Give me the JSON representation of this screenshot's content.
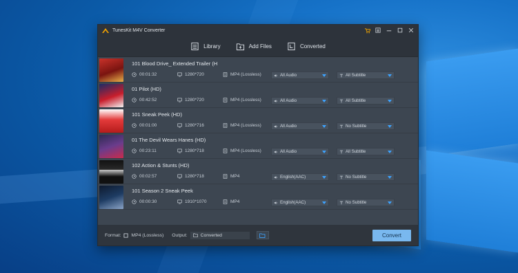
{
  "window": {
    "title": "TunesKit M4V Converter"
  },
  "toolbar": {
    "library_label": "Library",
    "add_files_label": "Add Files",
    "converted_label": "Converted"
  },
  "colors": {
    "accent": "#3da3ff",
    "convert_button": "#79b8ef",
    "window_bg": "#3d4651",
    "titlebar_bg": "#2d333b"
  },
  "rows": [
    {
      "title": "101 Blood Drive_ Extended Trailer (H",
      "duration": "00:01:32",
      "resolution": "1280*720",
      "format": "MP4 (Lossless)",
      "audio": "All Audio",
      "subtitle": "All Subtitle",
      "thumb_icon": "poster-blood-drive"
    },
    {
      "title": "01 Pilot (HD)",
      "duration": "00:42:52",
      "resolution": "1280*720",
      "format": "MP4 (Lossless)",
      "audio": "All Audio",
      "subtitle": "All Subtitle",
      "thumb_icon": "poster-pilot"
    },
    {
      "title": "101 Sneak Peek (HD)",
      "duration": "00:01:00",
      "resolution": "1280*716",
      "format": "MP4 (Lossless)",
      "audio": "All Audio",
      "subtitle": "No Subtitle",
      "thumb_icon": "poster-sneak-peek"
    },
    {
      "title": "01 The Devil Wears Hanes (HD)",
      "duration": "00:23:11",
      "resolution": "1280*718",
      "format": "MP4 (Lossless)",
      "audio": "All Audio",
      "subtitle": "All Subtitle",
      "thumb_icon": "poster-devil-wears-hanes"
    },
    {
      "title": "102 Action & Stunts (HD)",
      "duration": "00:02:57",
      "resolution": "1280*718",
      "format": "MP4",
      "audio": "English(AAC)",
      "subtitle": "No Subtitle",
      "thumb_icon": "poster-action-stunts"
    },
    {
      "title": "101 Season 2 Sneak Peek",
      "duration": "00:00:30",
      "resolution": "1910*1070",
      "format": "MP4",
      "audio": "English(AAC)",
      "subtitle": "No Subtitle",
      "thumb_icon": "poster-season-2"
    }
  ],
  "bottom": {
    "format_label": "Format:",
    "format_value": "MP4 (Lossless)",
    "output_label": "Output:",
    "output_value": "Converted",
    "convert_label": "Convert"
  }
}
